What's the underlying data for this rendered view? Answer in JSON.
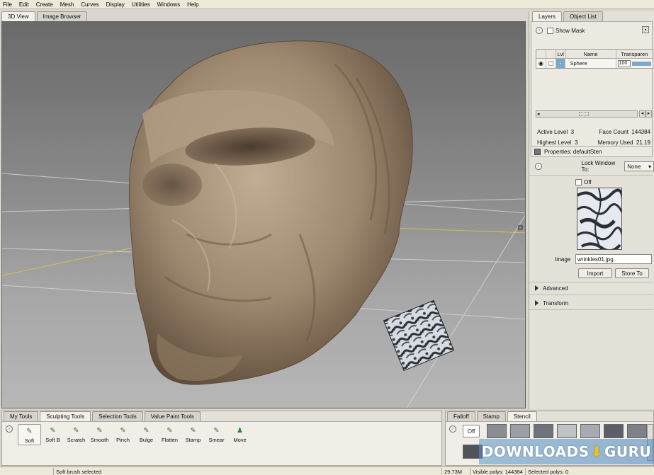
{
  "menu": [
    "File",
    "Edit",
    "Create",
    "Mesh",
    "Curves",
    "Display",
    "Utilities",
    "Windows",
    "Help"
  ],
  "viewport_tabs": [
    "3D View",
    "Image Browser"
  ],
  "layers_panel": {
    "tabs": [
      "Layers",
      "Object List"
    ],
    "show_mask_label": "Show Mask",
    "columns": [
      "Lvl",
      "Name",
      "Transparen"
    ],
    "rows": [
      {
        "lvl": "-",
        "name": "Sphere",
        "transparency": "100"
      }
    ],
    "info": {
      "active_level_label": "Active Level",
      "active_level_value": "3",
      "face_count_label": "Face Count",
      "face_count_value": "144384",
      "highest_level_label": "Highest Level",
      "highest_level_value": "3",
      "memory_used_label": "Memory Used",
      "memory_used_value": "21.19"
    }
  },
  "properties_panel": {
    "title": "Properties: defaultSten",
    "lock_window_label": "Lock Window To:",
    "lock_window_value": "None",
    "off_label": "Off",
    "image_label": "Image",
    "image_value": "wrinkles01.jpg",
    "import_label": "Import",
    "store_label": "Store To",
    "advanced_label": "Advanced",
    "transform_label": "Transform"
  },
  "tools_panel": {
    "tabs": [
      "My Tools",
      "Sculpting Tools",
      "Selection Tools",
      "Value Paint Tools"
    ],
    "tools": [
      "Soft",
      "Soft B",
      "Scratch",
      "Smooth",
      "Pinch",
      "Bulge",
      "Flatten",
      "Stamp",
      "Smear",
      "Move"
    ]
  },
  "stamp_panel": {
    "tabs": [
      "Falloff",
      "Stamp",
      "Stencil"
    ],
    "off_label": "Off"
  },
  "status_bar": {
    "message": "Soft brush selected",
    "memory": "29.73M",
    "visible_polys": "Visible polys: 144384",
    "selected_polys": "Selected polys: 0"
  },
  "watermark": {
    "left": "DOWNLOADS",
    "right": "GURU"
  },
  "colors": {
    "sculpt": "#a08a72",
    "accent": "#f1c21b"
  }
}
